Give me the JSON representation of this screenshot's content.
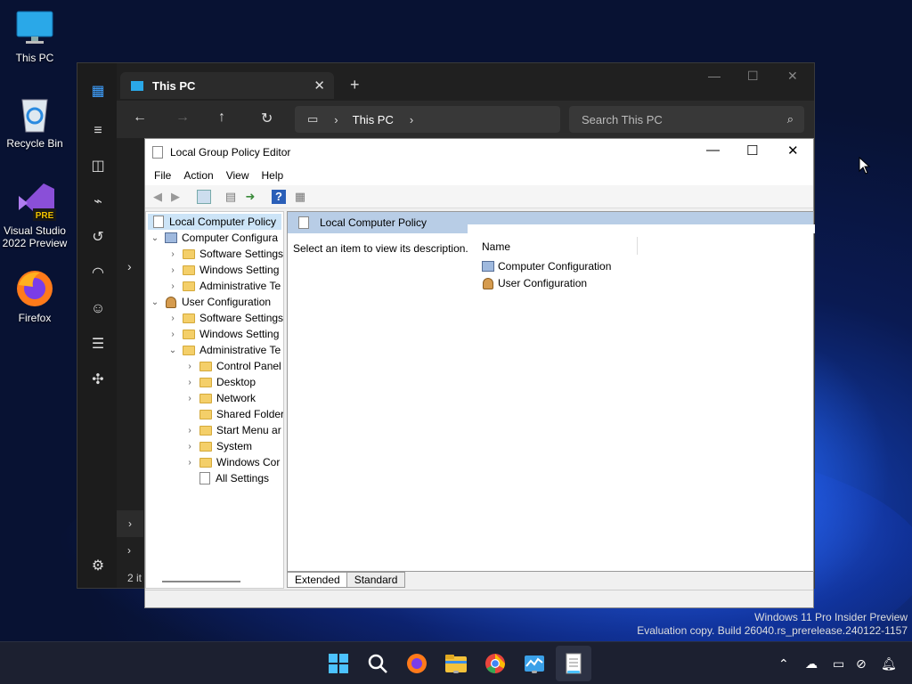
{
  "desktop": {
    "icons": [
      {
        "label": "This PC"
      },
      {
        "label": "Recycle Bin"
      },
      {
        "label": "Visual Studio\n2022 Preview",
        "badge": "PRE"
      },
      {
        "label": "Firefox"
      }
    ]
  },
  "explorer": {
    "tab_title": "This PC",
    "tab_close": "✕",
    "new_tab": "+",
    "breadcrumb": "This PC",
    "search_placeholder": "Search This PC",
    "status": "2 it"
  },
  "gpedit": {
    "title": "Local Group Policy Editor",
    "menu": [
      "File",
      "Action",
      "View",
      "Help"
    ],
    "tree": {
      "root": "Local Computer Policy",
      "computer_config": "Computer Configura",
      "cc_children": [
        "Software Settings",
        "Windows Setting",
        "Administrative Te"
      ],
      "user_config": "User Configuration",
      "uc_children": [
        "Software Settings",
        "Windows Setting",
        "Administrative Te"
      ],
      "admin_children": [
        "Control Panel",
        "Desktop",
        "Network",
        "Shared Folder",
        "Start Menu ar",
        "System",
        "Windows Cor",
        "All Settings"
      ]
    },
    "right": {
      "header": "Local Computer Policy",
      "description": "Select an item to view its description.",
      "column_name": "Name",
      "items": [
        "Computer Configuration",
        "User Configuration"
      ]
    },
    "tabs": [
      "Extended",
      "Standard"
    ]
  },
  "watermark": {
    "line1": "Windows 11 Pro Insider Preview",
    "line2": "Evaluation copy. Build 26040.rs_prerelease.240122-1157"
  },
  "colors": {
    "accent": "#0078d4",
    "gp_header_bg": "#b8cde6",
    "taskbar_bg": "#1c2030"
  }
}
